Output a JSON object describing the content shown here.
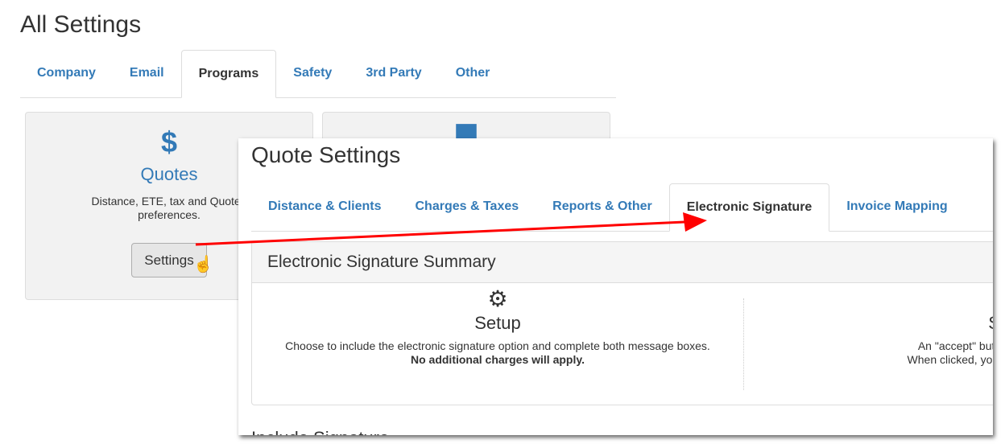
{
  "page": {
    "title": "All Settings"
  },
  "tabs": [
    {
      "label": "Company"
    },
    {
      "label": "Email"
    },
    {
      "label": "Programs",
      "active": true
    },
    {
      "label": "Safety"
    },
    {
      "label": "3rd Party"
    },
    {
      "label": "Other"
    }
  ],
  "cards": [
    {
      "icon": "dollar-icon",
      "icon_glyph": "$",
      "name": "Quotes",
      "desc": "Distance, ETE, tax and Quote/I preferences.",
      "button": "Settings"
    },
    {
      "icon": "calendar-icon",
      "icon_glyph": "▀"
    }
  ],
  "panel": {
    "title": "Quote Settings",
    "tabs": [
      {
        "label": "Distance & Clients"
      },
      {
        "label": "Charges & Taxes"
      },
      {
        "label": "Reports & Other"
      },
      {
        "label": "Electronic Signature",
        "active": true
      },
      {
        "label": "Invoice Mapping"
      }
    ],
    "summary": {
      "title": "Electronic Signature Summary",
      "setup": {
        "icon": "gear-icon",
        "title": "Setup",
        "text": "Choose to include the electronic signature option and complete both message boxes.",
        "bold": "No additional charges will apply."
      },
      "send": {
        "icon": "cloud-upload-icon",
        "title": "Send",
        "line1": "An \"accept\" button will be added just",
        "line2": "When clicked, your client can electronica"
      }
    },
    "next_heading": "Include Signature"
  },
  "colors": {
    "link": "#337ab7",
    "arrow": "#ff0000"
  }
}
